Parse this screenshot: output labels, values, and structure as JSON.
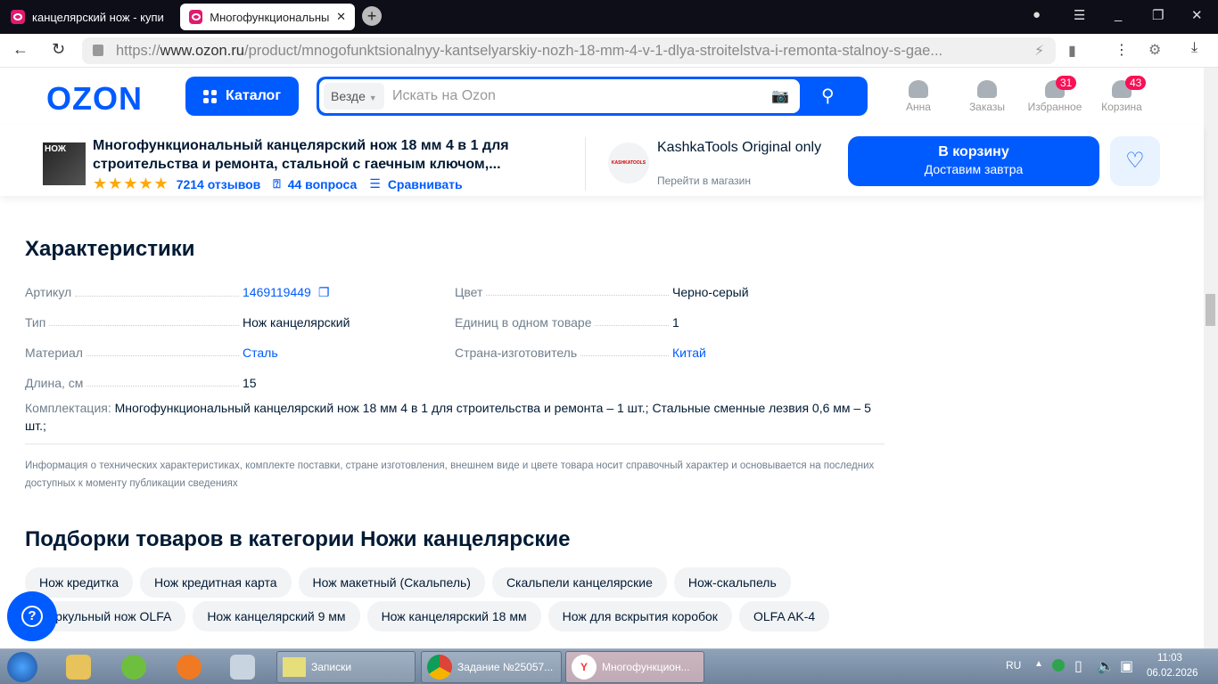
{
  "browser": {
    "tabs": [
      {
        "title": "канцелярский нож - купи"
      },
      {
        "title": "Многофункциональны",
        "active": true
      }
    ],
    "url_prefix": "https://",
    "url_host": "www.ozon.ru",
    "url_path": "/product/mnogofunktsionalnyy-kantselyarskiy-nozh-18-mm-4-v-1-dlya-stroitelstva-i-remonta-stalnoy-s-gae..."
  },
  "header": {
    "logo": "OZON",
    "catalog": "Каталог",
    "search_scope": "Везде",
    "search_placeholder": "Искать на Ozon",
    "nav": [
      {
        "label": "Анна",
        "icon": "user-icon"
      },
      {
        "label": "Заказы",
        "icon": "box-icon"
      },
      {
        "label": "Избранное",
        "icon": "heart-icon",
        "badge": "31"
      },
      {
        "label": "Корзина",
        "icon": "cart-icon",
        "badge": "43"
      }
    ]
  },
  "product": {
    "thumb_text": "НОЖ",
    "title": "Многофункциональный канцелярский нож 18 мм 4 в 1 для строительства и ремонта, стальной с гаечным ключом,...",
    "rating": 5,
    "reviews": "7214 отзывов",
    "questions": "44 вопроса",
    "compare": "Сравнивать",
    "seller": {
      "name": "KashkaTools Original only",
      "link": "Перейти в магазин",
      "logo_text": "KASHKATOOLS"
    },
    "cart_button": "В корзину",
    "cart_sub": "Доставим завтра"
  },
  "specs": {
    "title": "Характеристики",
    "left": [
      {
        "k": "Артикул",
        "v": "1469119449",
        "link": true
      },
      {
        "k": "Тип",
        "v": "Нож канцелярский"
      },
      {
        "k": "Материал",
        "v": "Сталь",
        "link": true
      },
      {
        "k": "Длина, см",
        "v": "15"
      }
    ],
    "right": [
      {
        "k": "Цвет",
        "v": "Черно-серый"
      },
      {
        "k": "Единиц в одном товаре",
        "v": "1"
      },
      {
        "k": "Страна-изготовитель",
        "v": "Китай",
        "link": true
      }
    ],
    "kompl_label": "Комплектация:",
    "kompl_value": "Многофункциональный канцелярский нож 18 мм 4 в 1 для строительства и ремонта – 1 шт.; Стальные сменные лезвия 0,6 мм – 5 шт.;",
    "disclaimer": "Информация о технических характеристиках, комплекте поставки, стране изготовления, внешнем виде и цвете товара носит справочный характер и основывается на последних доступных к моменту публикации сведениях"
  },
  "collections": {
    "title": "Подборки товаров в категории Ножи канцелярские",
    "row1": [
      "Нож кредитка",
      "Нож кредитная карта",
      "Нож макетный (Скальпель)",
      "Скальпели канцелярские",
      "Нож-скальпель"
    ],
    "row2": [
      "Циркульный нож OLFA",
      "Нож канцелярский 9 мм",
      "Нож канцелярский 18 мм",
      "Нож для вскрытия коробок",
      "OLFA AK-4"
    ]
  },
  "taskbar": {
    "apps": [
      {
        "label": "Записки"
      },
      {
        "label": "Задание №25057..."
      },
      {
        "label": "Многофункцион..."
      }
    ],
    "lang": "RU",
    "time": "11:03",
    "date": "06.02.2026"
  },
  "colors": {
    "accent": "#005bff",
    "badge": "#f91155",
    "star": "#ffa800"
  }
}
